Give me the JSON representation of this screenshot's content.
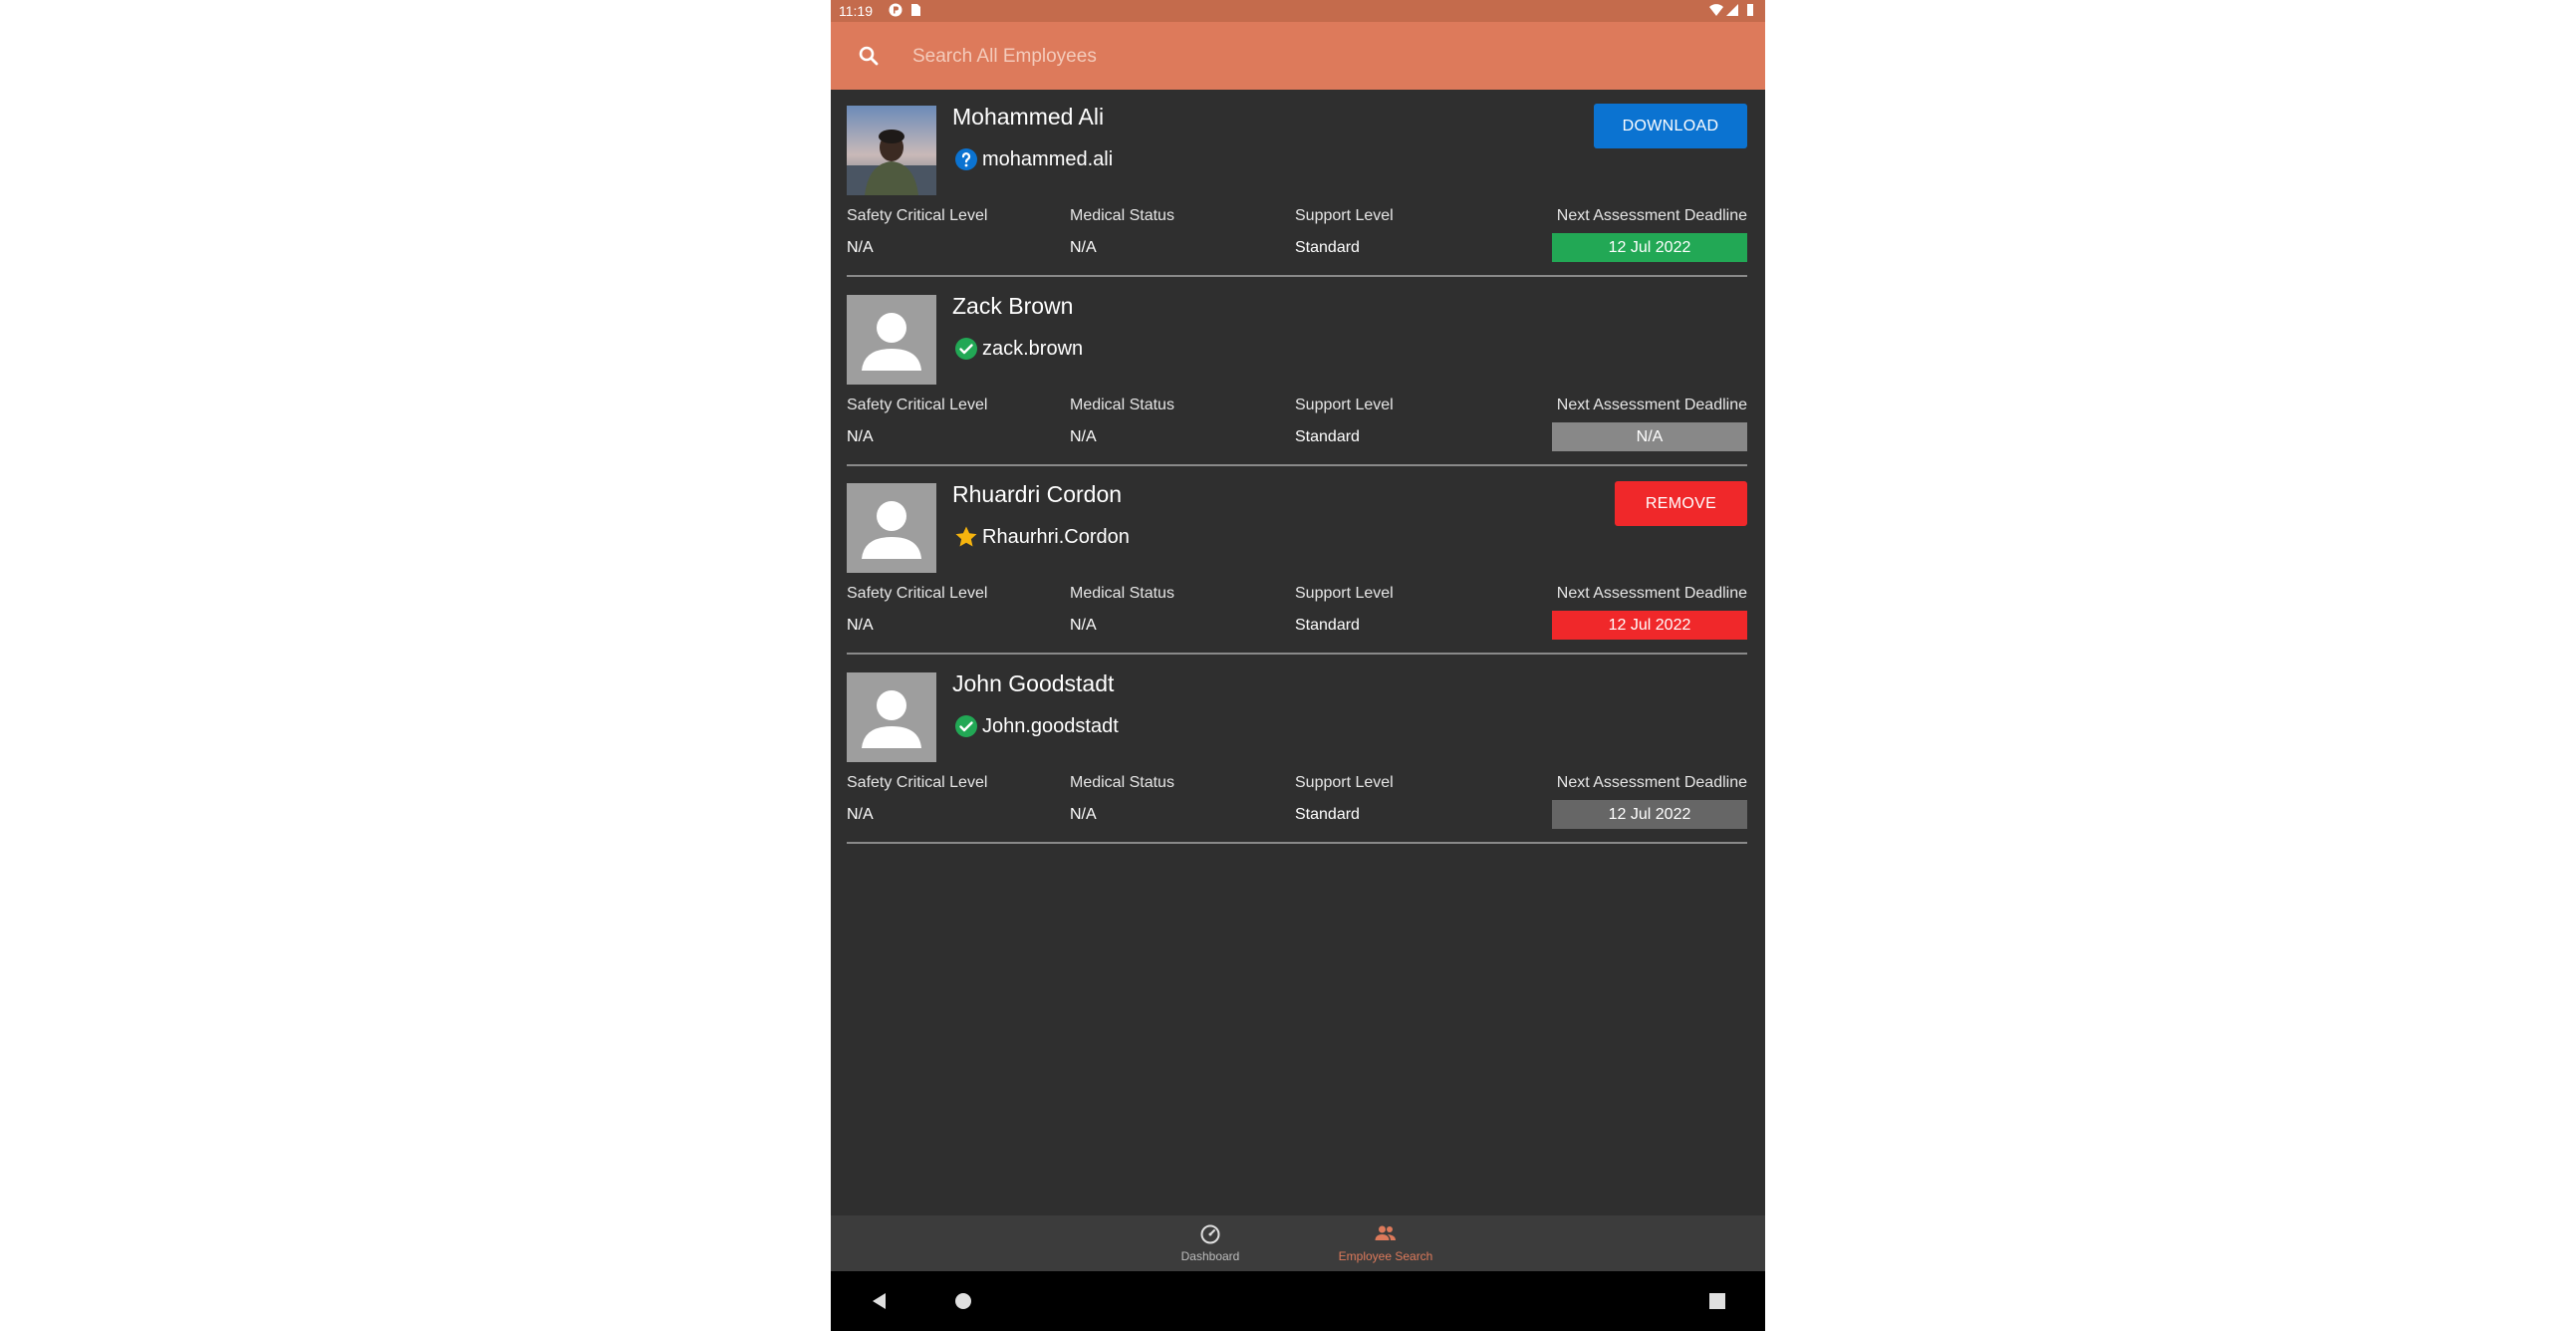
{
  "status_bar": {
    "time": "11:19",
    "left_icons": [
      "pocket-icon",
      "sd-card-icon"
    ],
    "right_icons": [
      "wifi-icon",
      "signal-icon",
      "battery-icon"
    ]
  },
  "search": {
    "placeholder": "Search All Employees",
    "value": "",
    "icon": "search-icon"
  },
  "colors": {
    "accent": "#dd7a5b",
    "status_bar": "#c46b4c",
    "background": "#2f2f2f",
    "download_button": "#0b73d1",
    "remove_button": "#f0282a",
    "deadline_green": "#22a855",
    "deadline_gray": "#888888",
    "deadline_red": "#f0282a",
    "deadline_dark_gray": "#666666"
  },
  "field_labels": {
    "safety": "Safety Critical Level",
    "medical": "Medical Status",
    "support": "Support Level",
    "deadline": "Next Assessment Deadline"
  },
  "employees": [
    {
      "name": "Mohammed Ali",
      "username": "mohammed.ali",
      "status_icon": "question-icon",
      "avatar": "photo",
      "safety_level": "N/A",
      "medical_status": "N/A",
      "support_level": "Standard",
      "deadline": "12 Jul 2022",
      "deadline_color": "green",
      "action_label": "DOWNLOAD"
    },
    {
      "name": "Zack Brown",
      "username": "zack.brown",
      "status_icon": "check-circle-icon",
      "avatar": "placeholder",
      "safety_level": "N/A",
      "medical_status": "N/A",
      "support_level": "Standard",
      "deadline": "N/A",
      "deadline_color": "gray"
    },
    {
      "name": "Rhuardri Cordon",
      "username": "Rhaurhri.Cordon",
      "status_icon": "star-icon",
      "avatar": "placeholder",
      "safety_level": "N/A",
      "medical_status": "N/A",
      "support_level": "Standard",
      "deadline": "12 Jul 2022",
      "deadline_color": "red",
      "action_label": "REMOVE"
    },
    {
      "name": "John Goodstadt",
      "username": "John.goodstadt",
      "status_icon": "check-circle-icon",
      "avatar": "placeholder",
      "safety_level": "N/A",
      "medical_status": "N/A",
      "support_level": "Standard",
      "deadline": "12 Jul 2022",
      "deadline_color": "dark-gray"
    }
  ],
  "bottom_nav": {
    "items": [
      {
        "label": "Dashboard",
        "icon": "dashboard-icon",
        "active": false
      },
      {
        "label": "Employee Search",
        "icon": "people-icon",
        "active": true
      }
    ]
  },
  "system_nav": [
    "back-icon",
    "home-icon",
    "recents-icon"
  ]
}
